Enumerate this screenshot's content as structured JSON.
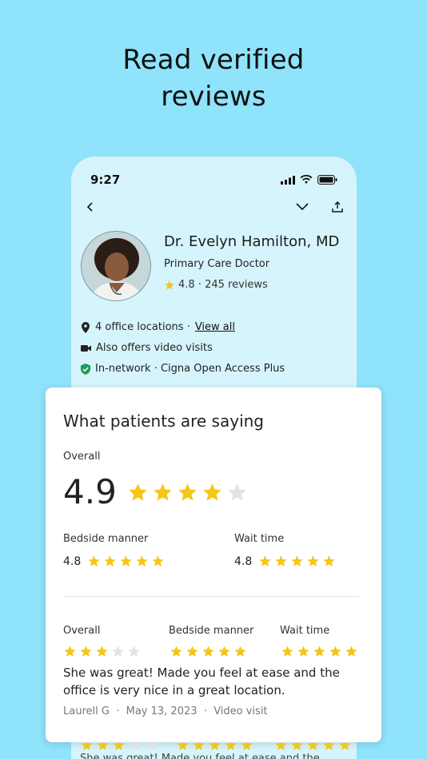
{
  "headline": {
    "line1": "Read verified",
    "line2": "reviews"
  },
  "status_bar": {
    "time": "9:27"
  },
  "doctor": {
    "name": "Dr. Evelyn Hamilton, MD",
    "specialty": "Primary Care Doctor",
    "rating_text": "4.8 · 245 reviews",
    "locations_text": "4 office locations ·",
    "view_all": "View all",
    "video_text": "Also offers video visits",
    "network_text": "In-network · Cigna Open Access Plus"
  },
  "reviews_card": {
    "title": "What patients are saying",
    "overall_label": "Overall",
    "overall_score": "4.9",
    "overall_stars": 4,
    "bedside_label": "Bedside manner",
    "bedside_value": "4.8",
    "bedside_stars": 5,
    "wait_label": "Wait time",
    "wait_value": "4.8",
    "wait_stars": 5,
    "review": {
      "overall_label": "Overall",
      "overall_stars": 3,
      "bedside_label": "Bedside manner",
      "bedside_stars": 5,
      "wait_label": "Wait time",
      "wait_stars": 5,
      "text": "She was great! Made you feel at ease and the office is very nice in a great location.",
      "author": "Laurell G",
      "date": "May 13, 2023",
      "visit_type": "Video visit"
    }
  },
  "peek_review": {
    "text": "She was great! Made you feel at ease and the"
  },
  "colors": {
    "background": "#8fe3fb",
    "phone": "#d6f4fc",
    "star": "#f5c518",
    "star_empty": "#e2e2e8",
    "shield": "#1a9e5c"
  }
}
